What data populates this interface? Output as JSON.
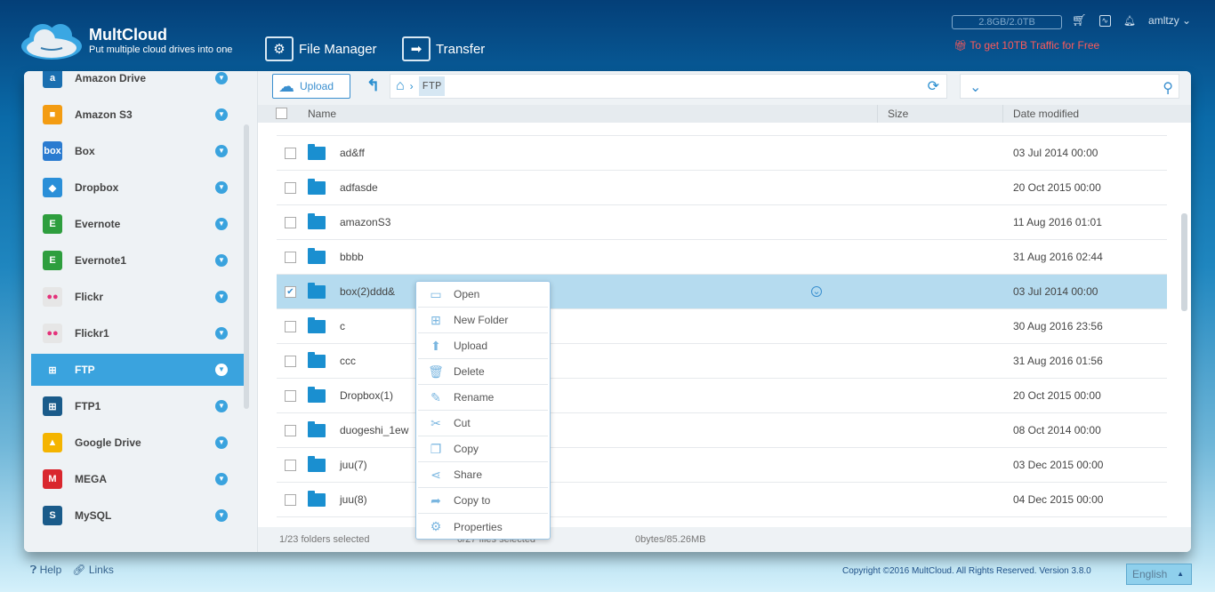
{
  "header": {
    "brand": "MultCloud",
    "tagline": "Put multiple cloud drives into one",
    "nav": [
      {
        "label": "File Manager",
        "icon": "gear-icon"
      },
      {
        "label": "Transfer",
        "icon": "arrow-right-icon"
      }
    ],
    "quota": "2.8GB/2.0TB",
    "user": "amltzy",
    "promo": "To get 10TB Traffic for Free"
  },
  "sidebar": {
    "items": [
      {
        "label": "Amazon Drive",
        "color": "#1a6fb0",
        "glyph": "a"
      },
      {
        "label": "Amazon S3",
        "color": "#f39c12",
        "glyph": "■"
      },
      {
        "label": "Box",
        "color": "#2a7bd0",
        "glyph": "box"
      },
      {
        "label": "Dropbox",
        "color": "#2a8fd8",
        "glyph": "◆"
      },
      {
        "label": "Evernote",
        "color": "#2e9e3e",
        "glyph": "E"
      },
      {
        "label": "Evernote1",
        "color": "#2e9e3e",
        "glyph": "E"
      },
      {
        "label": "Flickr",
        "color": "#e6e6e6",
        "glyph": "●●"
      },
      {
        "label": "Flickr1",
        "color": "#e6e6e6",
        "glyph": "●●"
      },
      {
        "label": "FTP",
        "color": "#3aa3de",
        "glyph": "⊞"
      },
      {
        "label": "FTP1",
        "color": "#1a5b8a",
        "glyph": "⊞"
      },
      {
        "label": "Google Drive",
        "color": "#f4b400",
        "glyph": "▲"
      },
      {
        "label": "MEGA",
        "color": "#d9272e",
        "glyph": "M"
      },
      {
        "label": "MySQL",
        "color": "#1a5b8a",
        "glyph": "S"
      }
    ],
    "active": "FTP"
  },
  "toolbar": {
    "upload": "Upload",
    "path_current": "FTP"
  },
  "table": {
    "headers": {
      "name": "Name",
      "size": "Size",
      "date": "Date modified"
    },
    "rows": [
      {
        "name": "ad&ff",
        "date": "03 Jul 2014 00:00"
      },
      {
        "name": "adfasde",
        "date": "20 Oct 2015 00:00"
      },
      {
        "name": "amazonS3",
        "date": "11 Aug 2016 01:01"
      },
      {
        "name": "bbbb",
        "date": "31 Aug 2016 02:44"
      },
      {
        "name": "box(2)ddd&",
        "date": "03 Jul 2014 00:00",
        "selected": true
      },
      {
        "name": "c",
        "date": "30 Aug 2016 23:56"
      },
      {
        "name": "ccc",
        "date": "31 Aug 2016 01:56"
      },
      {
        "name": "Dropbox(1)",
        "date": "20 Oct 2015 00:00"
      },
      {
        "name": "duogeshi_1ew",
        "date": "08 Oct 2014 00:00"
      },
      {
        "name": "juu(7)",
        "date": "03 Dec 2015 00:00"
      },
      {
        "name": "juu(8)",
        "date": "04 Dec 2015 00:00"
      }
    ]
  },
  "context_menu": [
    {
      "label": "Open",
      "icon": "folder-open-icon",
      "glyph": "▭"
    },
    {
      "label": "New Folder",
      "icon": "new-folder-icon",
      "glyph": "⊞"
    },
    {
      "label": "Upload",
      "icon": "upload-icon",
      "glyph": "⬆"
    },
    {
      "label": "Delete",
      "icon": "trash-icon",
      "glyph": "🗑"
    },
    {
      "label": "Rename",
      "icon": "pencil-icon",
      "glyph": "✎"
    },
    {
      "label": "Cut",
      "icon": "scissors-icon",
      "glyph": "✂"
    },
    {
      "label": "Copy",
      "icon": "copy-icon",
      "glyph": "❐"
    },
    {
      "label": "Share",
      "icon": "share-icon",
      "glyph": "⋖"
    },
    {
      "label": "Copy to",
      "icon": "copy-to-icon",
      "glyph": "➦"
    },
    {
      "label": "Properties",
      "icon": "gear-icon",
      "glyph": "⚙"
    }
  ],
  "status": {
    "folders": "1/23 folders selected",
    "files": "0/27 files selected",
    "size": "0bytes/85.26MB"
  },
  "footer": {
    "help": "Help",
    "links": "Links",
    "copyright": "Copyright ©2016 MultCloud. All Rights Reserved. Version 3.8.0",
    "language": "English"
  }
}
